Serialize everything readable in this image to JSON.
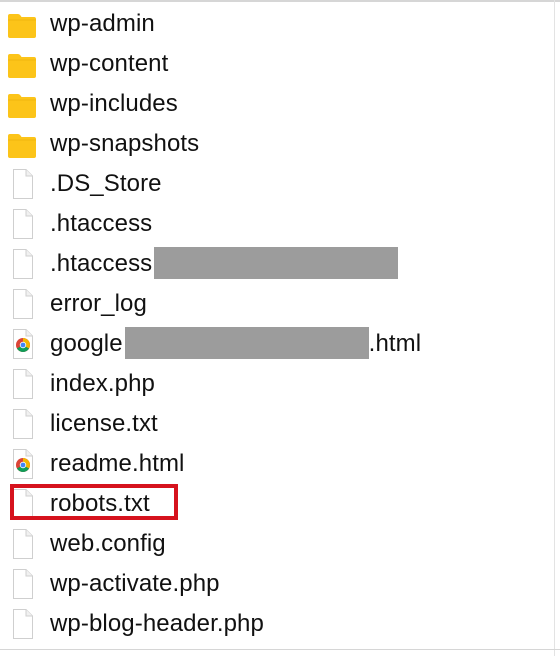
{
  "files": [
    {
      "name": "wp-admin",
      "icon": "folder-icon",
      "type": "folder"
    },
    {
      "name": "wp-content",
      "icon": "folder-icon",
      "type": "folder"
    },
    {
      "name": "wp-includes",
      "icon": "folder-icon",
      "type": "folder"
    },
    {
      "name": "wp-snapshots",
      "icon": "folder-icon",
      "type": "folder"
    },
    {
      "name": ".DS_Store",
      "icon": "document-icon",
      "type": "file"
    },
    {
      "name": ".htaccess",
      "icon": "document-icon",
      "type": "file"
    },
    {
      "name": ".htaccess",
      "icon": "document-icon",
      "type": "file",
      "redacted": true
    },
    {
      "name": "error_log",
      "icon": "document-icon",
      "type": "file"
    },
    {
      "name_prefix": "google",
      "name_suffix": ".html",
      "icon": "chrome-html-icon",
      "type": "file",
      "redacted": true
    },
    {
      "name": "index.php",
      "icon": "document-icon",
      "type": "file"
    },
    {
      "name": "license.txt",
      "icon": "document-icon",
      "type": "file"
    },
    {
      "name": "readme.html",
      "icon": "chrome-html-icon",
      "type": "file"
    },
    {
      "name": "robots.txt",
      "icon": "document-icon",
      "type": "file",
      "highlighted": true
    },
    {
      "name": "web.config",
      "icon": "document-icon",
      "type": "file"
    },
    {
      "name": "wp-activate.php",
      "icon": "document-icon",
      "type": "file"
    },
    {
      "name": "wp-blog-header.php",
      "icon": "document-icon",
      "type": "file"
    }
  ],
  "colors": {
    "folder": "#fcc419",
    "highlight": "#d6121d",
    "redaction": "#9c9c9c"
  }
}
